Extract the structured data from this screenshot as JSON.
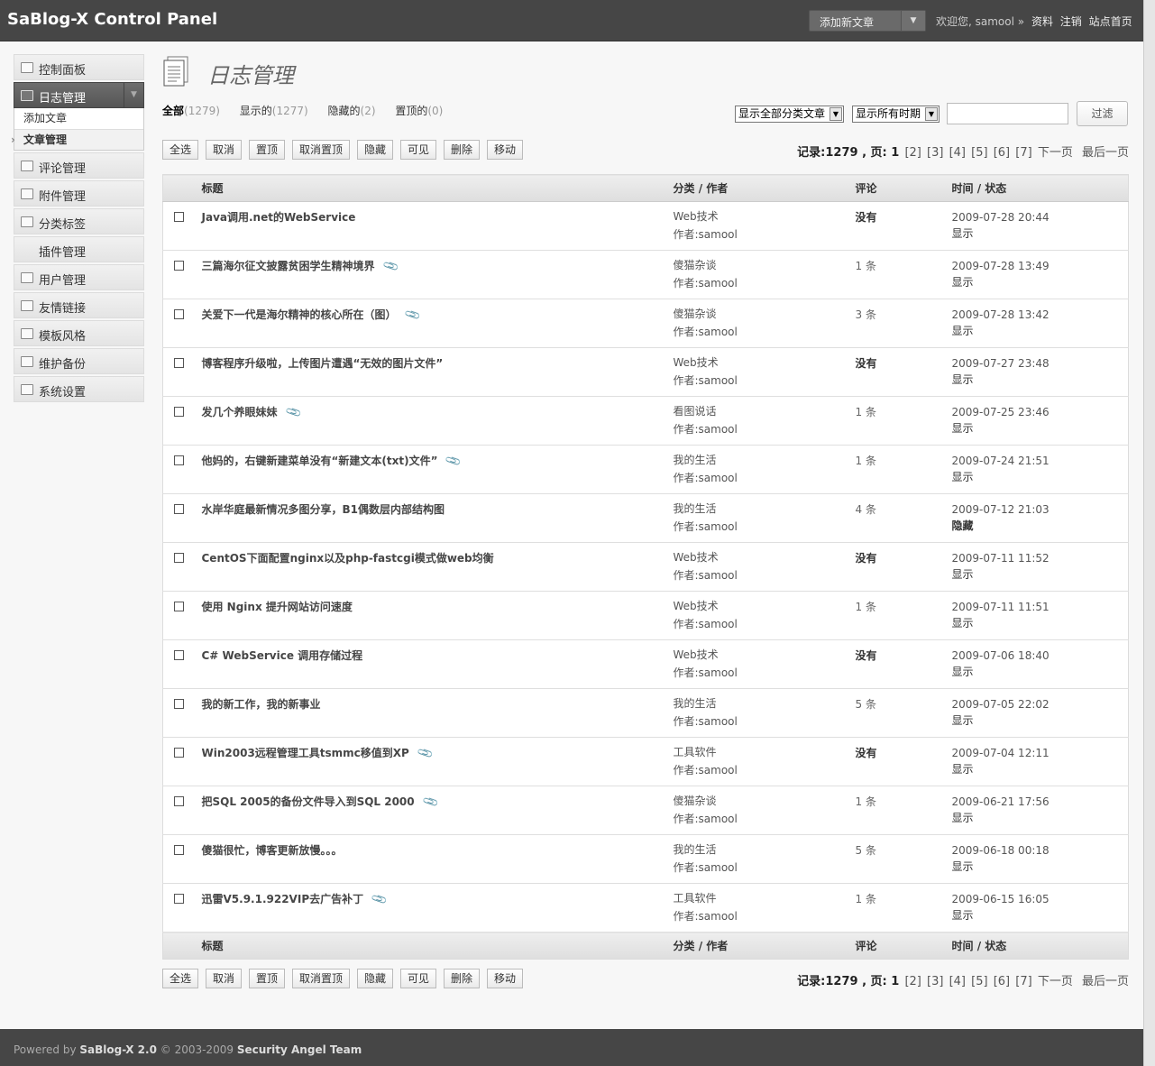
{
  "app": {
    "title": "SaBlog-X Control Panel"
  },
  "header": {
    "add_new": "添加新文章",
    "welcome": "欢迎您, samool »",
    "links": [
      "资料",
      "注销",
      "站点首页"
    ]
  },
  "sidebar": {
    "items": [
      {
        "label": "控制面板",
        "icon": "dashboard-icon"
      },
      {
        "label": "日志管理",
        "icon": "posts-icon",
        "active": true
      },
      {
        "label": "评论管理",
        "icon": "comments-icon"
      },
      {
        "label": "附件管理",
        "icon": "attachments-icon"
      },
      {
        "label": "分类标签",
        "icon": "pin-icon"
      },
      {
        "label": "插件管理",
        "icon": ""
      },
      {
        "label": "用户管理",
        "icon": "users-icon"
      },
      {
        "label": "友情链接",
        "icon": "link-icon"
      },
      {
        "label": "模板风格",
        "icon": "template-icon"
      },
      {
        "label": "维护备份",
        "icon": "tools-icon"
      },
      {
        "label": "系统设置",
        "icon": "settings-icon"
      }
    ],
    "submenu": [
      "添加文章",
      "文章管理"
    ]
  },
  "main": {
    "title": "日志管理",
    "filters": [
      {
        "label": "全部",
        "count": "(1279)"
      },
      {
        "label": "显示的",
        "count": "(1277)"
      },
      {
        "label": "隐藏的",
        "count": "(2)"
      },
      {
        "label": "置顶的",
        "count": "(0)"
      }
    ],
    "category_select": "显示全部分类文章",
    "date_select": "显示所有时期",
    "search_value": "",
    "filter_button": "过滤",
    "actions": [
      "全选",
      "取消",
      "置顶",
      "取消置顶",
      "隐藏",
      "可见",
      "删除",
      "移动"
    ],
    "pager": {
      "records": "记录:1279 , 页: 1",
      "pages": [
        "[2]",
        "[3]",
        "[4]",
        "[5]",
        "[6]",
        "[7]"
      ],
      "next": "下一页",
      "last": "最后一页"
    },
    "columns": {
      "title": "标题",
      "cat": "分类",
      "author": "/ 作者",
      "comments": "评论",
      "time": "时间",
      "status": "/ 状态"
    },
    "rows": [
      {
        "title": "Java调用.net的WebService",
        "clip": false,
        "cat": "Web技术",
        "author": "作者:samool",
        "comments": "没有",
        "time": "2009-07-28 20:44",
        "status": "显示"
      },
      {
        "title": "三篇海尔征文披露贫困学生精神境界",
        "clip": true,
        "cat": "傻猫杂谈",
        "author": "作者:samool",
        "comments": "1 条",
        "time": "2009-07-28 13:49",
        "status": "显示"
      },
      {
        "title": "关爱下一代是海尔精神的核心所在（图）",
        "clip": true,
        "cat": "傻猫杂谈",
        "author": "作者:samool",
        "comments": "3 条",
        "time": "2009-07-28 13:42",
        "status": "显示"
      },
      {
        "title": "博客程序升级啦，上传图片遭遇“无效的图片文件”",
        "clip": false,
        "cat": "Web技术",
        "author": "作者:samool",
        "comments": "没有",
        "time": "2009-07-27 23:48",
        "status": "显示"
      },
      {
        "title": "发几个养眼妹妹",
        "clip": true,
        "cat": "看图说话",
        "author": "作者:samool",
        "comments": "1 条",
        "time": "2009-07-25 23:46",
        "status": "显示"
      },
      {
        "title": "他妈的，右键新建菜单没有“新建文本(txt)文件”",
        "clip": true,
        "cat": "我的生活",
        "author": "作者:samool",
        "comments": "1 条",
        "time": "2009-07-24 21:51",
        "status": "显示"
      },
      {
        "title": "水岸华庭最新情况多图分享，B1偶数层内部结构图",
        "clip": false,
        "cat": "我的生活",
        "author": "作者:samool",
        "comments": "4 条",
        "time": "2009-07-12 21:03",
        "status": "隐藏"
      },
      {
        "title": "CentOS下面配置nginx以及php-fastcgi模式做web均衡",
        "clip": false,
        "cat": "Web技术",
        "author": "作者:samool",
        "comments": "没有",
        "time": "2009-07-11 11:52",
        "status": "显示"
      },
      {
        "title": "使用 Nginx 提升网站访问速度",
        "clip": false,
        "cat": "Web技术",
        "author": "作者:samool",
        "comments": "1 条",
        "time": "2009-07-11 11:51",
        "status": "显示"
      },
      {
        "title": "C# WebService 调用存储过程",
        "clip": false,
        "cat": "Web技术",
        "author": "作者:samool",
        "comments": "没有",
        "time": "2009-07-06 18:40",
        "status": "显示"
      },
      {
        "title": "我的新工作，我的新事业",
        "clip": false,
        "cat": "我的生活",
        "author": "作者:samool",
        "comments": "5 条",
        "time": "2009-07-05 22:02",
        "status": "显示"
      },
      {
        "title": "Win2003远程管理工具tsmmc移值到XP",
        "clip": true,
        "cat": "工具软件",
        "author": "作者:samool",
        "comments": "没有",
        "time": "2009-07-04 12:11",
        "status": "显示"
      },
      {
        "title": "把SQL 2005的备份文件导入到SQL 2000",
        "clip": true,
        "cat": "傻猫杂谈",
        "author": "作者:samool",
        "comments": "1 条",
        "time": "2009-06-21 17:56",
        "status": "显示"
      },
      {
        "title": "傻猫很忙，博客更新放慢。。。",
        "clip": false,
        "cat": "我的生活",
        "author": "作者:samool",
        "comments": "5 条",
        "time": "2009-06-18 00:18",
        "status": "显示"
      },
      {
        "title": "迅雷V5.9.1.922VIP去广告补丁",
        "clip": true,
        "cat": "工具软件",
        "author": "作者:samool",
        "comments": "1 条",
        "time": "2009-06-15 16:05",
        "status": "显示"
      }
    ]
  },
  "footer": {
    "prefix": "Powered by",
    "product": "SaBlog-X 2.0",
    "years": "© 2003-2009",
    "team": "Security Angel Team"
  }
}
